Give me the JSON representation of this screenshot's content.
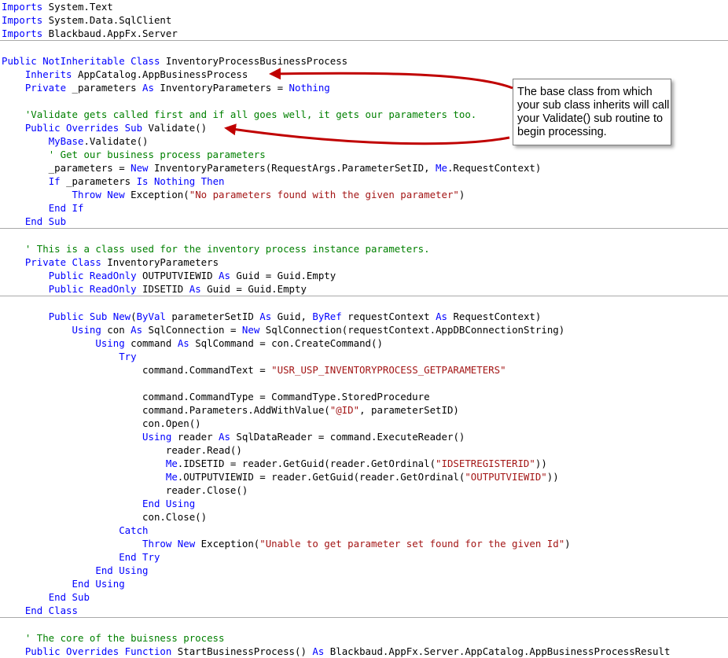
{
  "colors": {
    "keyword": "#0000ff",
    "comment": "#008000",
    "string": "#a31515",
    "text": "#000000",
    "arrow": "#c00000"
  },
  "callout": {
    "text": "The base class from which your sub class inherits will call your Validate() sub routine to begin processing."
  },
  "code": [
    {
      "t": "line",
      "tokens": [
        {
          "k": "kw",
          "s": "Imports"
        },
        {
          "k": "tx",
          "s": " System.Text"
        }
      ]
    },
    {
      "t": "line",
      "tokens": [
        {
          "k": "kw",
          "s": "Imports"
        },
        {
          "k": "tx",
          "s": " System.Data.SqlClient"
        }
      ]
    },
    {
      "t": "line",
      "tokens": [
        {
          "k": "kw",
          "s": "Imports"
        },
        {
          "k": "tx",
          "s": " Blackbaud.AppFx.Server"
        }
      ]
    },
    {
      "t": "sep"
    },
    {
      "t": "line",
      "tokens": []
    },
    {
      "t": "line",
      "tokens": [
        {
          "k": "kw",
          "s": "Public NotInheritable Class"
        },
        {
          "k": "tx",
          "s": " InventoryProcessBusinessProcess"
        }
      ]
    },
    {
      "t": "line",
      "tokens": [
        {
          "k": "tx",
          "s": "    "
        },
        {
          "k": "kw",
          "s": "Inherits"
        },
        {
          "k": "tx",
          "s": " AppCatalog.AppBusinessProcess"
        }
      ]
    },
    {
      "t": "line",
      "tokens": [
        {
          "k": "tx",
          "s": "    "
        },
        {
          "k": "kw",
          "s": "Private"
        },
        {
          "k": "tx",
          "s": " _parameters "
        },
        {
          "k": "kw",
          "s": "As"
        },
        {
          "k": "tx",
          "s": " InventoryParameters = "
        },
        {
          "k": "kw",
          "s": "Nothing"
        }
      ]
    },
    {
      "t": "line",
      "tokens": []
    },
    {
      "t": "line",
      "tokens": [
        {
          "k": "tx",
          "s": "    "
        },
        {
          "k": "cm",
          "s": "'Validate gets called first and if all goes well, it gets our parameters too."
        }
      ]
    },
    {
      "t": "line",
      "tokens": [
        {
          "k": "tx",
          "s": "    "
        },
        {
          "k": "kw",
          "s": "Public Overrides Sub"
        },
        {
          "k": "tx",
          "s": " Validate()"
        }
      ]
    },
    {
      "t": "line",
      "tokens": [
        {
          "k": "tx",
          "s": "        "
        },
        {
          "k": "kw",
          "s": "MyBase"
        },
        {
          "k": "tx",
          "s": ".Validate()"
        }
      ]
    },
    {
      "t": "line",
      "tokens": [
        {
          "k": "tx",
          "s": "        "
        },
        {
          "k": "cm",
          "s": "' Get our business process parameters"
        }
      ]
    },
    {
      "t": "line",
      "tokens": [
        {
          "k": "tx",
          "s": "        _parameters = "
        },
        {
          "k": "kw",
          "s": "New"
        },
        {
          "k": "tx",
          "s": " InventoryParameters(RequestArgs.ParameterSetID, "
        },
        {
          "k": "kw",
          "s": "Me"
        },
        {
          "k": "tx",
          "s": ".RequestContext)"
        }
      ]
    },
    {
      "t": "line",
      "tokens": [
        {
          "k": "tx",
          "s": "        "
        },
        {
          "k": "kw",
          "s": "If"
        },
        {
          "k": "tx",
          "s": " _parameters "
        },
        {
          "k": "kw",
          "s": "Is Nothing Then"
        }
      ]
    },
    {
      "t": "line",
      "tokens": [
        {
          "k": "tx",
          "s": "            "
        },
        {
          "k": "kw",
          "s": "Throw New"
        },
        {
          "k": "tx",
          "s": " Exception("
        },
        {
          "k": "st",
          "s": "\"No parameters found with the given parameter\""
        },
        {
          "k": "tx",
          "s": ")"
        }
      ]
    },
    {
      "t": "line",
      "tokens": [
        {
          "k": "tx",
          "s": "        "
        },
        {
          "k": "kw",
          "s": "End If"
        }
      ]
    },
    {
      "t": "line",
      "tokens": [
        {
          "k": "tx",
          "s": "    "
        },
        {
          "k": "kw",
          "s": "End Sub"
        }
      ]
    },
    {
      "t": "sep"
    },
    {
      "t": "line",
      "tokens": []
    },
    {
      "t": "line",
      "tokens": [
        {
          "k": "tx",
          "s": "    "
        },
        {
          "k": "cm",
          "s": "' This is a class used for the inventory process instance parameters."
        }
      ]
    },
    {
      "t": "line",
      "tokens": [
        {
          "k": "tx",
          "s": "    "
        },
        {
          "k": "kw",
          "s": "Private Class"
        },
        {
          "k": "tx",
          "s": " InventoryParameters"
        }
      ]
    },
    {
      "t": "line",
      "tokens": [
        {
          "k": "tx",
          "s": "        "
        },
        {
          "k": "kw",
          "s": "Public ReadOnly"
        },
        {
          "k": "tx",
          "s": " OUTPUTVIEWID "
        },
        {
          "k": "kw",
          "s": "As"
        },
        {
          "k": "tx",
          "s": " Guid = Guid.Empty"
        }
      ]
    },
    {
      "t": "line",
      "tokens": [
        {
          "k": "tx",
          "s": "        "
        },
        {
          "k": "kw",
          "s": "Public ReadOnly"
        },
        {
          "k": "tx",
          "s": " IDSETID "
        },
        {
          "k": "kw",
          "s": "As"
        },
        {
          "k": "tx",
          "s": " Guid = Guid.Empty"
        }
      ]
    },
    {
      "t": "sep"
    },
    {
      "t": "line",
      "tokens": []
    },
    {
      "t": "line",
      "tokens": [
        {
          "k": "tx",
          "s": "        "
        },
        {
          "k": "kw",
          "s": "Public Sub New"
        },
        {
          "k": "tx",
          "s": "("
        },
        {
          "k": "kw",
          "s": "ByVal"
        },
        {
          "k": "tx",
          "s": " parameterSetID "
        },
        {
          "k": "kw",
          "s": "As"
        },
        {
          "k": "tx",
          "s": " Guid, "
        },
        {
          "k": "kw",
          "s": "ByRef"
        },
        {
          "k": "tx",
          "s": " requestContext "
        },
        {
          "k": "kw",
          "s": "As"
        },
        {
          "k": "tx",
          "s": " RequestContext)"
        }
      ]
    },
    {
      "t": "line",
      "tokens": [
        {
          "k": "tx",
          "s": "            "
        },
        {
          "k": "kw",
          "s": "Using"
        },
        {
          "k": "tx",
          "s": " con "
        },
        {
          "k": "kw",
          "s": "As"
        },
        {
          "k": "tx",
          "s": " SqlConnection = "
        },
        {
          "k": "kw",
          "s": "New"
        },
        {
          "k": "tx",
          "s": " SqlConnection(requestContext.AppDBConnectionString)"
        }
      ]
    },
    {
      "t": "line",
      "tokens": [
        {
          "k": "tx",
          "s": "                "
        },
        {
          "k": "kw",
          "s": "Using"
        },
        {
          "k": "tx",
          "s": " command "
        },
        {
          "k": "kw",
          "s": "As"
        },
        {
          "k": "tx",
          "s": " SqlCommand = con.CreateCommand()"
        }
      ]
    },
    {
      "t": "line",
      "tokens": [
        {
          "k": "tx",
          "s": "                    "
        },
        {
          "k": "kw",
          "s": "Try"
        }
      ]
    },
    {
      "t": "line",
      "tokens": [
        {
          "k": "tx",
          "s": "                        command.CommandText = "
        },
        {
          "k": "st",
          "s": "\"USR_USP_INVENTORYPROCESS_GETPARAMETERS\""
        }
      ]
    },
    {
      "t": "line",
      "tokens": []
    },
    {
      "t": "line",
      "tokens": [
        {
          "k": "tx",
          "s": "                        command.CommandType = CommandType.StoredProcedure"
        }
      ]
    },
    {
      "t": "line",
      "tokens": [
        {
          "k": "tx",
          "s": "                        command.Parameters.AddWithValue("
        },
        {
          "k": "st",
          "s": "\"@ID\""
        },
        {
          "k": "tx",
          "s": ", parameterSetID)"
        }
      ]
    },
    {
      "t": "line",
      "tokens": [
        {
          "k": "tx",
          "s": "                        con.Open()"
        }
      ]
    },
    {
      "t": "line",
      "tokens": [
        {
          "k": "tx",
          "s": "                        "
        },
        {
          "k": "kw",
          "s": "Using"
        },
        {
          "k": "tx",
          "s": " reader "
        },
        {
          "k": "kw",
          "s": "As"
        },
        {
          "k": "tx",
          "s": " SqlDataReader = command.ExecuteReader()"
        }
      ]
    },
    {
      "t": "line",
      "tokens": [
        {
          "k": "tx",
          "s": "                            reader.Read()"
        }
      ]
    },
    {
      "t": "line",
      "tokens": [
        {
          "k": "tx",
          "s": "                            "
        },
        {
          "k": "kw",
          "s": "Me"
        },
        {
          "k": "tx",
          "s": ".IDSETID = reader.GetGuid(reader.GetOrdinal("
        },
        {
          "k": "st",
          "s": "\"IDSETREGISTERID\""
        },
        {
          "k": "tx",
          "s": "))"
        }
      ]
    },
    {
      "t": "line",
      "tokens": [
        {
          "k": "tx",
          "s": "                            "
        },
        {
          "k": "kw",
          "s": "Me"
        },
        {
          "k": "tx",
          "s": ".OUTPUTVIEWID = reader.GetGuid(reader.GetOrdinal("
        },
        {
          "k": "st",
          "s": "\"OUTPUTVIEWID\""
        },
        {
          "k": "tx",
          "s": "))"
        }
      ]
    },
    {
      "t": "line",
      "tokens": [
        {
          "k": "tx",
          "s": "                            reader.Close()"
        }
      ]
    },
    {
      "t": "line",
      "tokens": [
        {
          "k": "tx",
          "s": "                        "
        },
        {
          "k": "kw",
          "s": "End Using"
        }
      ]
    },
    {
      "t": "line",
      "tokens": [
        {
          "k": "tx",
          "s": "                        con.Close()"
        }
      ]
    },
    {
      "t": "line",
      "tokens": [
        {
          "k": "tx",
          "s": "                    "
        },
        {
          "k": "kw",
          "s": "Catch"
        }
      ]
    },
    {
      "t": "line",
      "tokens": [
        {
          "k": "tx",
          "s": "                        "
        },
        {
          "k": "kw",
          "s": "Throw New"
        },
        {
          "k": "tx",
          "s": " Exception("
        },
        {
          "k": "st",
          "s": "\"Unable to get parameter set found for the given Id\""
        },
        {
          "k": "tx",
          "s": ")"
        }
      ]
    },
    {
      "t": "line",
      "tokens": [
        {
          "k": "tx",
          "s": "                    "
        },
        {
          "k": "kw",
          "s": "End Try"
        }
      ]
    },
    {
      "t": "line",
      "tokens": [
        {
          "k": "tx",
          "s": "                "
        },
        {
          "k": "kw",
          "s": "End Using"
        }
      ]
    },
    {
      "t": "line",
      "tokens": [
        {
          "k": "tx",
          "s": "            "
        },
        {
          "k": "kw",
          "s": "End Using"
        }
      ]
    },
    {
      "t": "line",
      "tokens": [
        {
          "k": "tx",
          "s": "        "
        },
        {
          "k": "kw",
          "s": "End Sub"
        }
      ]
    },
    {
      "t": "line",
      "tokens": [
        {
          "k": "tx",
          "s": "    "
        },
        {
          "k": "kw",
          "s": "End Class"
        }
      ]
    },
    {
      "t": "sep"
    },
    {
      "t": "line",
      "tokens": []
    },
    {
      "t": "line",
      "tokens": [
        {
          "k": "tx",
          "s": "    "
        },
        {
          "k": "cm",
          "s": "' The core of the buisness process"
        }
      ]
    },
    {
      "t": "line",
      "tokens": [
        {
          "k": "tx",
          "s": "    "
        },
        {
          "k": "kw",
          "s": "Public Overrides Function"
        },
        {
          "k": "tx",
          "s": " StartBusinessProcess() "
        },
        {
          "k": "kw",
          "s": "As"
        },
        {
          "k": "tx",
          "s": " Blackbaud.AppFx.Server.AppCatalog.AppBusinessProcessResult"
        }
      ]
    }
  ]
}
